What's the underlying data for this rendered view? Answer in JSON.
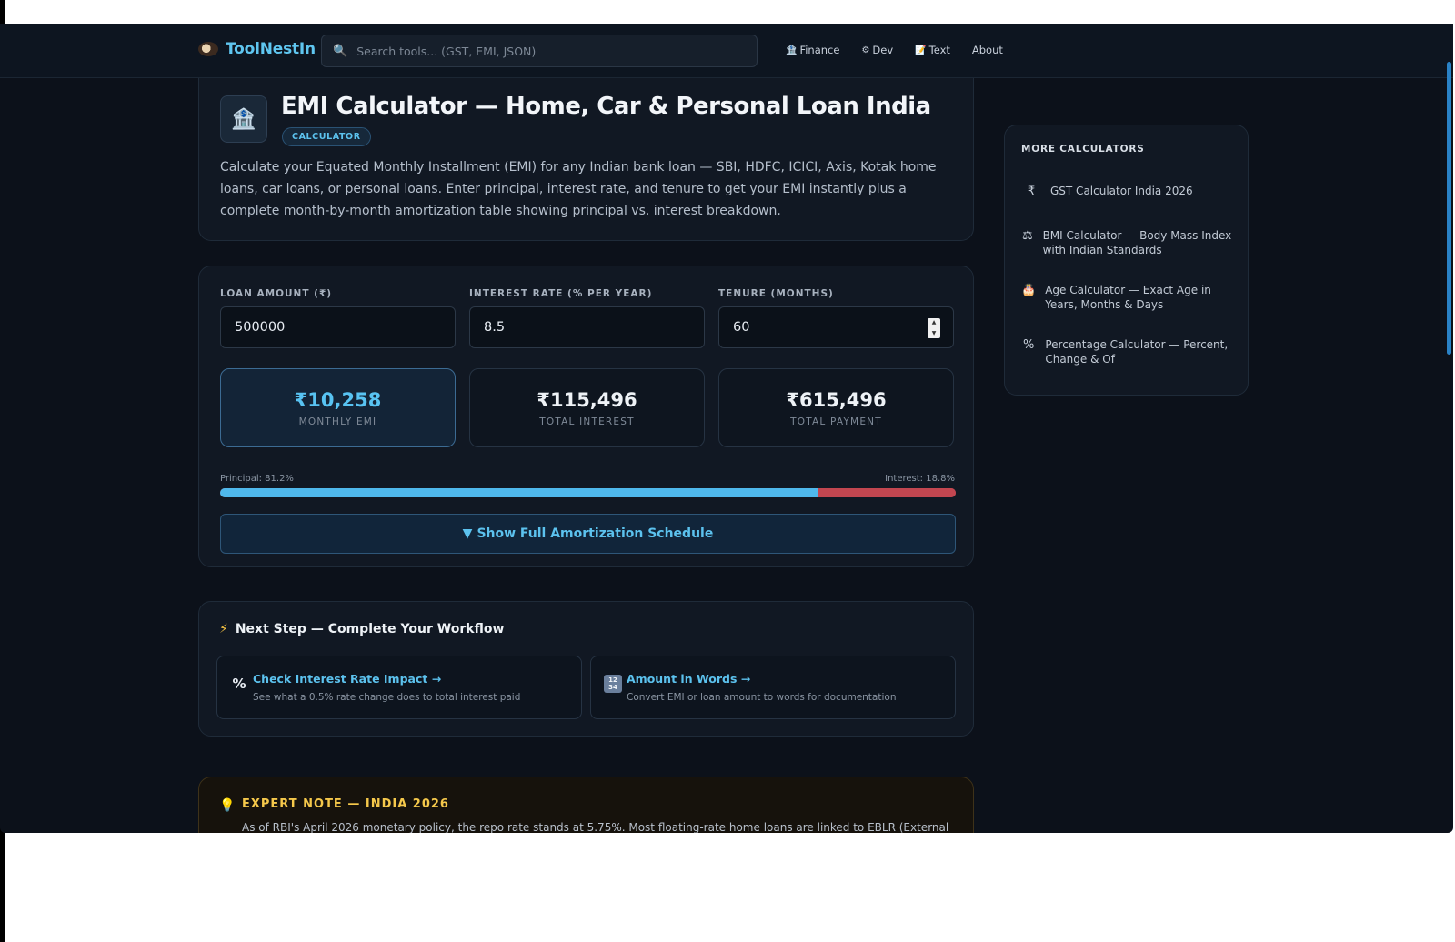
{
  "brand": {
    "name": "ToolNestIn"
  },
  "search": {
    "placeholder": "Search tools... (GST, EMI, JSON)"
  },
  "nav": [
    {
      "icon": "🏦",
      "label": "Finance"
    },
    {
      "icon": "⚙",
      "label": "Dev"
    },
    {
      "icon": "📝",
      "label": "Text"
    },
    {
      "icon": "",
      "label": "About"
    }
  ],
  "header": {
    "title": "EMI Calculator — Home, Car & Personal Loan India",
    "badge": "CALCULATOR",
    "intro": "Calculate your Equated Monthly Installment (EMI) for any Indian bank loan — SBI, HDFC, ICICI, Axis, Kotak home loans, car loans, or personal loans. Enter principal, interest rate, and tenure to get your EMI instantly plus a complete month-by-month amortization table showing principal vs. interest breakdown."
  },
  "inputs": {
    "loan_label": "LOAN AMOUNT (₹)",
    "loan_value": "500000",
    "rate_label": "INTEREST RATE (% PER YEAR)",
    "rate_value": "8.5",
    "tenure_label": "TENURE (MONTHS)",
    "tenure_value": "60"
  },
  "results": {
    "emi_value": "₹10,258",
    "emi_label": "MONTHLY EMI",
    "interest_value": "₹115,496",
    "interest_label": "TOTAL INTEREST",
    "payment_value": "₹615,496",
    "payment_label": "TOTAL PAYMENT"
  },
  "breakdown": {
    "principal_label": "Principal: 81.2%",
    "interest_label": "Interest: 18.8%",
    "principal_pct": 81.2,
    "interest_pct": 18.8,
    "colors": {
      "principal": "#4fb8ec",
      "interest": "#c24650"
    }
  },
  "schedule_button": {
    "icon": "▼",
    "label": "Show Full Amortization Schedule"
  },
  "next_step": {
    "title": "Next Step — Complete Your Workflow",
    "links": [
      {
        "icon": "percent-icon",
        "title": "Check Interest Rate Impact →",
        "sub": "See what a 0.5% rate change does to total interest paid"
      },
      {
        "icon": "numbers-icon",
        "title": "Amount in Words →",
        "sub": "Convert EMI or loan amount to words for documentation"
      }
    ]
  },
  "expert": {
    "title": "EXPERT NOTE — INDIA 2026",
    "text": "As of RBI's April 2026 monetary policy, the repo rate stands at 5.75%. Most floating-rate home loans are linked to EBLR (External"
  },
  "sidebar": {
    "title": "MORE CALCULATORS",
    "items": [
      {
        "icon": "₹",
        "label": "GST Calculator India 2026"
      },
      {
        "icon": "⚖",
        "label": "BMI Calculator — Body Mass Index with Indian Standards"
      },
      {
        "icon": "🎂",
        "label": "Age Calculator — Exact Age in Years, Months & Days"
      },
      {
        "icon": "%",
        "label": "Percentage Calculator — Percent, Change & Of"
      }
    ]
  }
}
